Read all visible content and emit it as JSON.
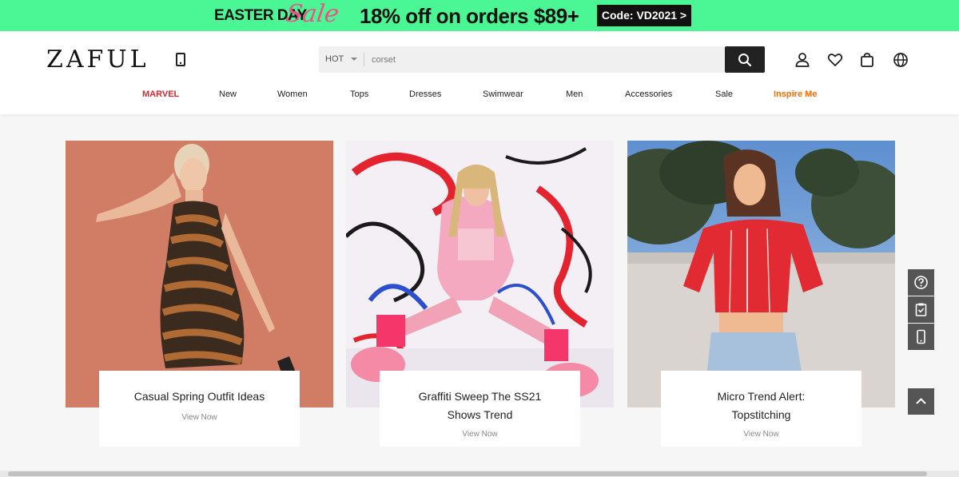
{
  "promo": {
    "easter": "EASTER DAY",
    "sale": "Sale",
    "offer": "18% off on orders $89+",
    "code": "Code: VD2021 >"
  },
  "header": {
    "logo": "ZAFUL",
    "search": {
      "category": "HOT",
      "value": "corset"
    },
    "icons": [
      "mobile-app-icon",
      "user-icon",
      "heart-icon",
      "bag-icon",
      "globe-icon",
      "search-icon"
    ]
  },
  "nav": {
    "items": [
      "MARVEL",
      "New",
      "Women",
      "Tops",
      "Dresses",
      "Swimwear",
      "Men",
      "Accessories",
      "Sale",
      "Inspire Me"
    ]
  },
  "cards": [
    {
      "title": "Casual Spring Outfit Ideas",
      "link": "View Now",
      "bg": "#cf7a62"
    },
    {
      "title_line1": "Graffiti Sweep The SS21",
      "title_line2": "Shows Trend",
      "link": "View Now",
      "bg": "#f2eef2"
    },
    {
      "title_line1": "Micro Trend Alert:",
      "title_line2": "Topstitching",
      "link": "View Now",
      "bg": "#7fa8d8"
    }
  ],
  "colors": {
    "promo_bg": "#4bf795",
    "sale_pink": "#f0508a",
    "marvel_red": "#d7262e",
    "inspire_orange": "#ff6a00"
  }
}
